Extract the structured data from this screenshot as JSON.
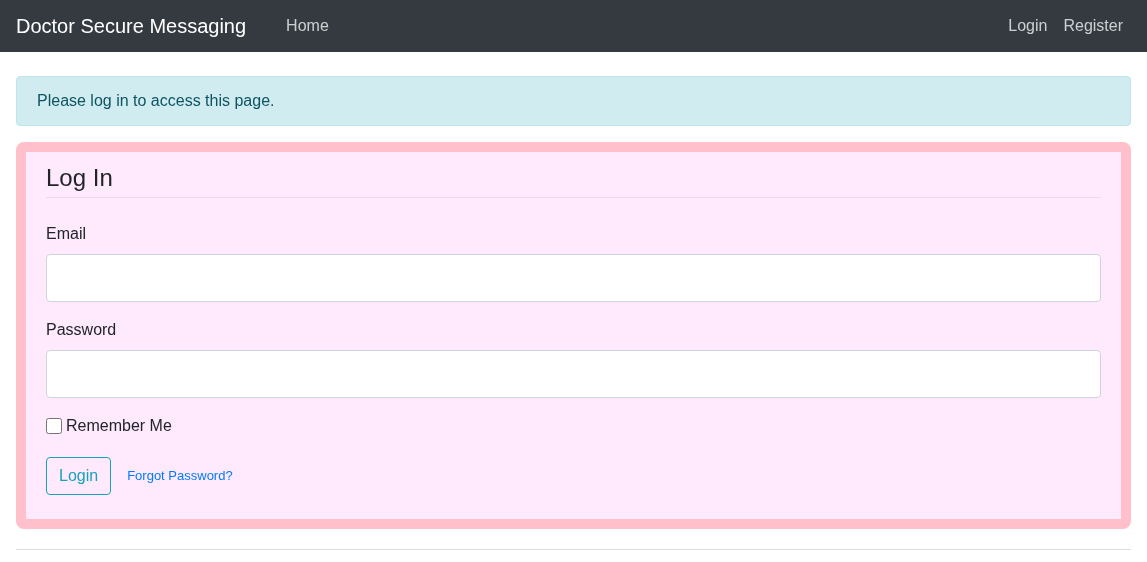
{
  "navbar": {
    "brand": "Doctor Secure Messaging",
    "left_links": [
      "Home"
    ],
    "right_links": [
      "Login",
      "Register"
    ]
  },
  "alert": {
    "text": "Please log in to access this page."
  },
  "login_form": {
    "title": "Log In",
    "fields": [
      {
        "label": "Email"
      },
      {
        "label": "Password"
      }
    ],
    "remember_me": {
      "label": "Remember Me",
      "checked": false
    },
    "submit_button": "Login",
    "forgot_link": "Forgot Password?"
  }
}
